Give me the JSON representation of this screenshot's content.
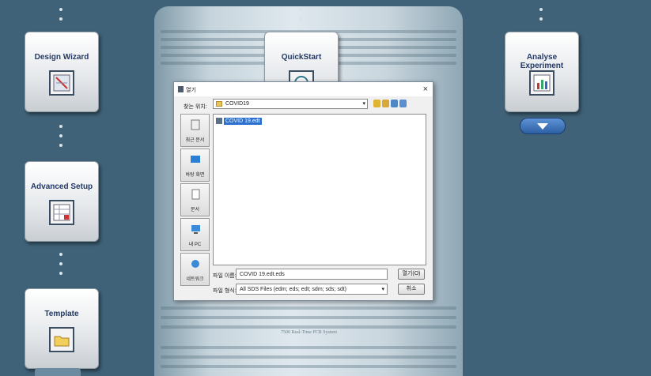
{
  "tiles": {
    "design_wizard": "Design Wizard",
    "quickstart": "QuickStart",
    "analyse_experiment": "Analyse Experiment",
    "advanced_setup": "Advanced Setup",
    "template": "Template"
  },
  "instrument_label": "7500 Real-Time PCR System",
  "dialog": {
    "title": "열기",
    "close_glyph": "×",
    "look_in_label": "찾는 위치:",
    "look_in_value": "COVID19",
    "places": [
      {
        "label": "최근 문서"
      },
      {
        "label": "바탕 화면"
      },
      {
        "label": "문서"
      },
      {
        "label": "내 PC"
      },
      {
        "label": "네트워크"
      }
    ],
    "files": [
      {
        "name": "COVID 19.edt"
      }
    ],
    "file_name_label": "파일 이름:",
    "file_name_value": "COVID 19.edt.eds",
    "file_type_label": "파일 형식:",
    "file_type_value": "All SDS Files (edm; eds; edt; sdm; sds; sdt)",
    "open_button": "열기(O)",
    "cancel_button": "취소"
  },
  "colors": {
    "background": "#3f6278",
    "tile_label": "#233a66",
    "selection": "#2b6fcf"
  }
}
